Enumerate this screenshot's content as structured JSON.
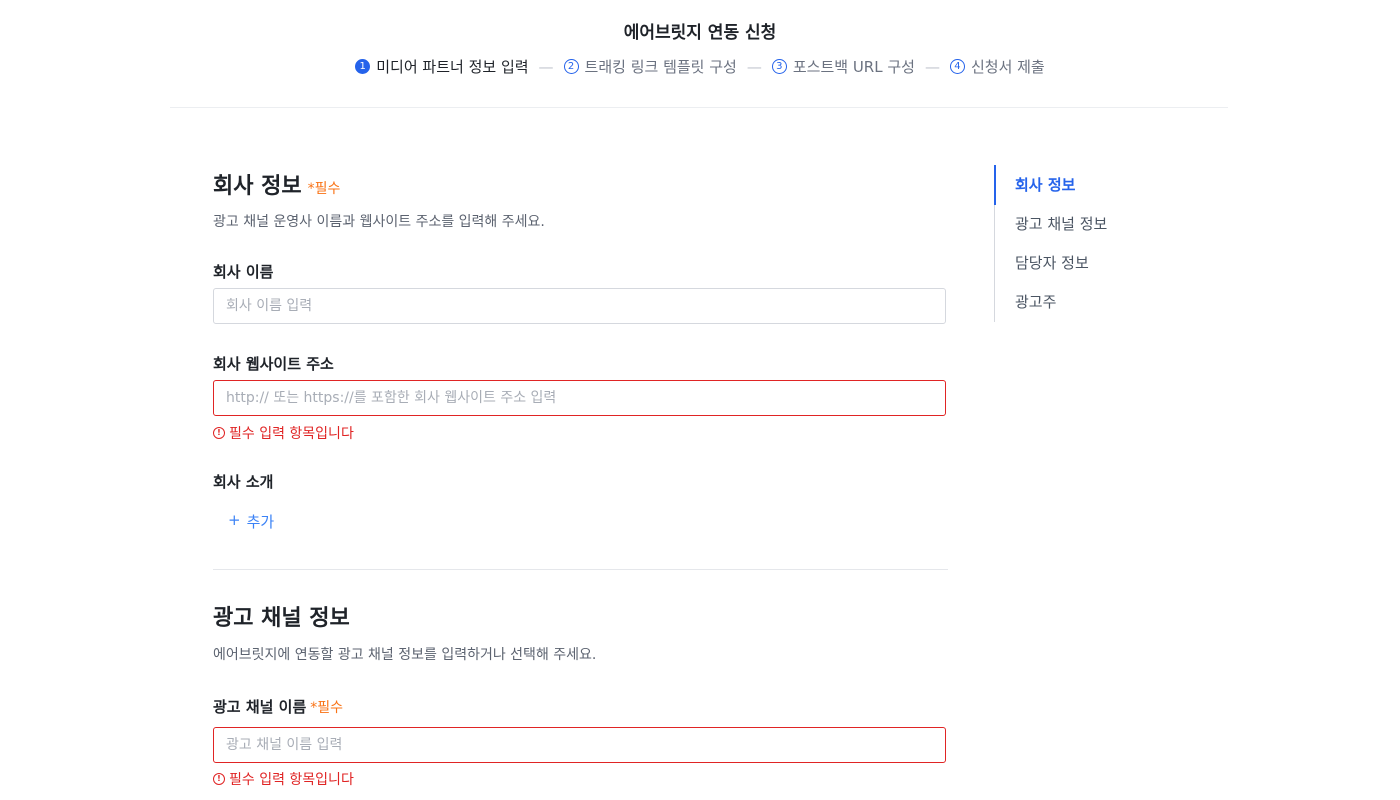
{
  "header": {
    "title": "에어브릿지 연동 신청",
    "steps": [
      {
        "num": "1",
        "label": "미디어 파트너 정보 입력",
        "active": true
      },
      {
        "num": "2",
        "label": "트래킹 링크 템플릿 구성",
        "active": false
      },
      {
        "num": "3",
        "label": "포스트백 URL 구성",
        "active": false
      },
      {
        "num": "4",
        "label": "신청서 제출",
        "active": false
      }
    ],
    "separator": "—"
  },
  "company_section": {
    "title": "회사 정보",
    "required": "*필수",
    "description": "광고 채널 운영사 이름과 웹사이트 주소를 입력해 주세요.",
    "name_label": "회사 이름",
    "name_placeholder": "회사 이름 입력",
    "name_value": "",
    "website_label": "회사 웹사이트 주소",
    "website_placeholder": "http:// 또는 https://를 포함한 회사 웹사이트 주소 입력",
    "website_value": "",
    "website_error": "필수 입력 항목입니다",
    "intro_label": "회사 소개",
    "add_plus": "+",
    "add_label": "추가"
  },
  "channel_section": {
    "title": "광고 채널 정보",
    "description": "에어브릿지에 연동할 광고 채널 정보를 입력하거나 선택해 주세요.",
    "name_label": "광고 채널 이름",
    "required": "*필수",
    "name_placeholder": "광고 채널 이름 입력",
    "name_value": "",
    "name_error": "필수 입력 항목입니다"
  },
  "error_icon": "!",
  "toc": {
    "items": [
      "회사 정보",
      "광고 채널 정보",
      "담당자 정보",
      "광고주"
    ],
    "active_index": 0
  },
  "colors": {
    "accent": "#2563eb",
    "error": "#e02424",
    "required": "#f97316",
    "link": "#3b82f6"
  },
  "icons": {
    "error": "error-circle-icon",
    "step": "step-number-circle-icon"
  }
}
